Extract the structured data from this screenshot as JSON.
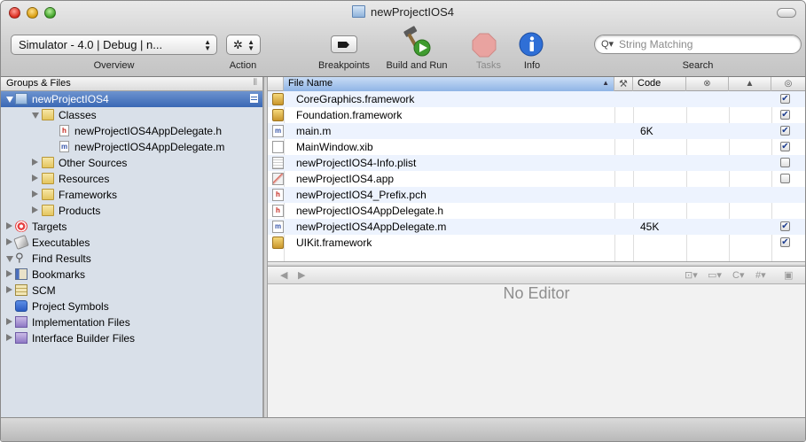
{
  "window": {
    "title": "newProjectIOS4"
  },
  "toolbar": {
    "overview_value": "Simulator - 4.0 | Debug | n...",
    "overview_label": "Overview",
    "action_label": "Action",
    "breakpoints_label": "Breakpoints",
    "build_run_label": "Build and Run",
    "tasks_label": "Tasks",
    "info_label": "Info",
    "search_placeholder": "String Matching",
    "search_label": "Search"
  },
  "sidebar": {
    "header": "Groups & Files",
    "items": [
      {
        "label": "newProjectIOS4"
      },
      {
        "label": "Classes"
      },
      {
        "label": "newProjectIOS4AppDelegate.h"
      },
      {
        "label": "newProjectIOS4AppDelegate.m"
      },
      {
        "label": "Other Sources"
      },
      {
        "label": "Resources"
      },
      {
        "label": "Frameworks"
      },
      {
        "label": "Products"
      },
      {
        "label": "Targets"
      },
      {
        "label": "Executables"
      },
      {
        "label": "Find Results"
      },
      {
        "label": "Bookmarks"
      },
      {
        "label": "SCM"
      },
      {
        "label": "Project Symbols"
      },
      {
        "label": "Implementation Files"
      },
      {
        "label": "Interface Builder Files"
      }
    ]
  },
  "filelist": {
    "headers": {
      "file_name": "File Name",
      "code": "Code"
    },
    "rows": [
      {
        "name": "CoreGraphics.framework",
        "code": "",
        "checked": true
      },
      {
        "name": "Foundation.framework",
        "code": "",
        "checked": true
      },
      {
        "name": "main.m",
        "code": "6K",
        "checked": true
      },
      {
        "name": "MainWindow.xib",
        "code": "",
        "checked": true
      },
      {
        "name": "newProjectIOS4-Info.plist",
        "code": "",
        "checked": false
      },
      {
        "name": "newProjectIOS4.app",
        "code": "",
        "checked": false
      },
      {
        "name": "newProjectIOS4_Prefix.pch",
        "code": "",
        "checked": null
      },
      {
        "name": "newProjectIOS4AppDelegate.h",
        "code": "",
        "checked": null
      },
      {
        "name": "newProjectIOS4AppDelegate.m",
        "code": "45K",
        "checked": true
      },
      {
        "name": "UIKit.framework",
        "code": "",
        "checked": true
      }
    ]
  },
  "editor": {
    "placeholder": "No Editor"
  },
  "colors": {
    "selection": "#3a68b5",
    "sidebar_bg": "#d9e0e9",
    "stripe": "#edf3fe"
  }
}
